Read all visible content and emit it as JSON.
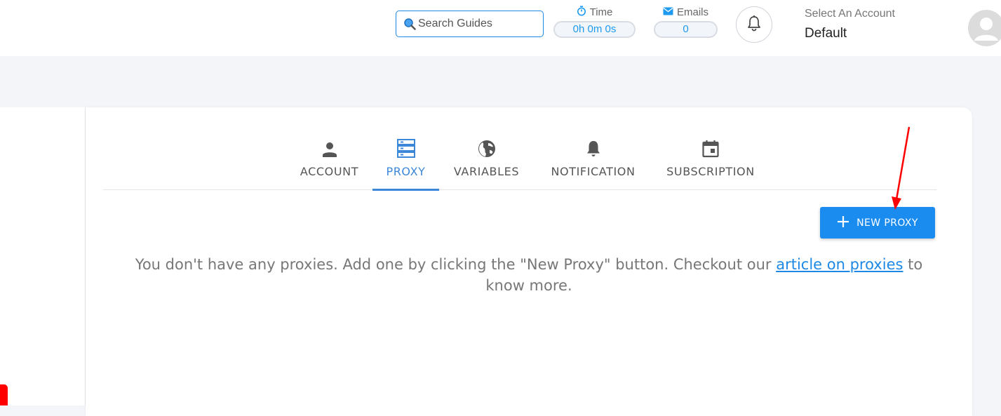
{
  "header": {
    "search": {
      "placeholder": "Search Guides",
      "value": ""
    },
    "time": {
      "label": "Time",
      "value": "0h 0m 0s"
    },
    "emails": {
      "label": "Emails",
      "value": "0"
    },
    "account": {
      "label": "Select An Account",
      "value": "Default"
    }
  },
  "tabs": [
    {
      "label": "ACCOUNT",
      "icon": "person-icon",
      "active": false
    },
    {
      "label": "PROXY",
      "icon": "server-icon",
      "active": true
    },
    {
      "label": "VARIABLES",
      "icon": "globe-icon",
      "active": false
    },
    {
      "label": "NOTIFICATION",
      "icon": "bell-icon",
      "active": false
    },
    {
      "label": "SUBSCRIPTION",
      "icon": "calendar-icon",
      "active": false
    }
  ],
  "proxy": {
    "new_button_label": "NEW PROXY",
    "empty_text_before": "You don't have any proxies. Add one by clicking the \"New Proxy\" button. Checkout our ",
    "empty_link_text": "article on proxies",
    "empty_text_after": " to know more."
  },
  "colors": {
    "accent": "#1a8cf0",
    "active_tab": "#3d87d8",
    "annotation_arrow": "#ff0000"
  }
}
